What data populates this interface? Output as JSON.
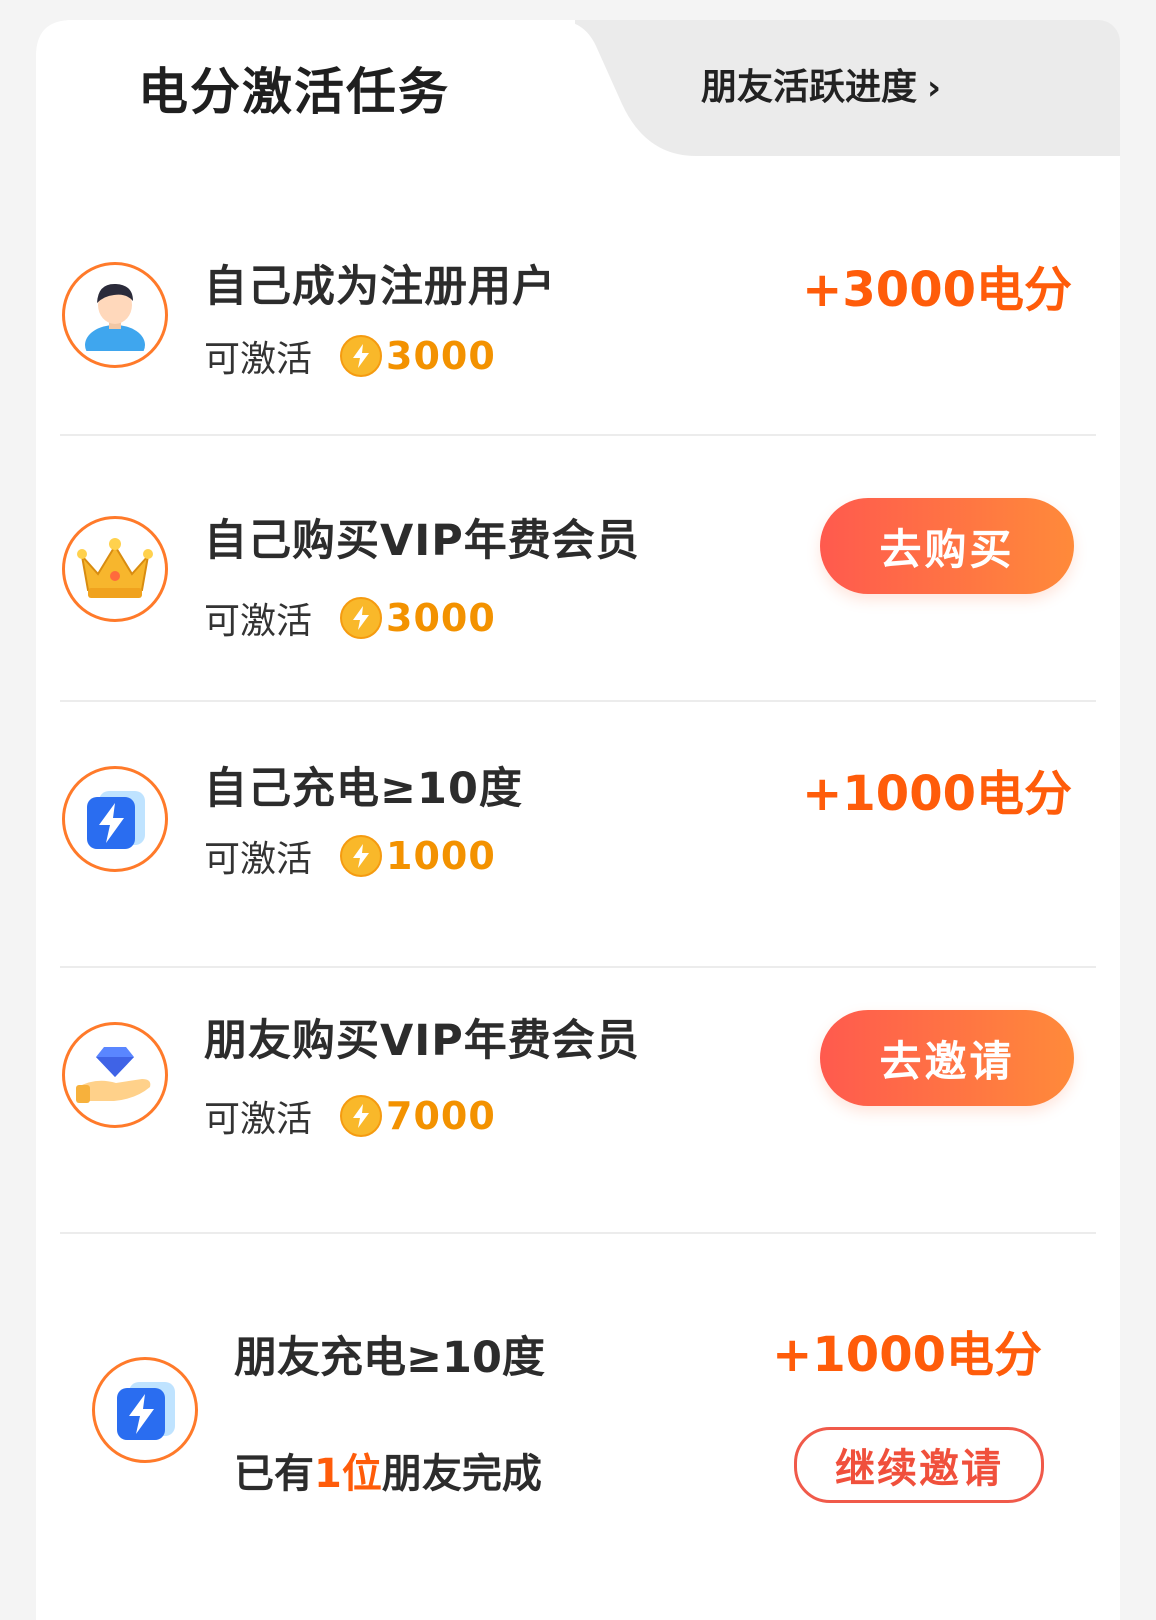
{
  "header": {
    "active_tab": "电分激活任务",
    "inactive_tab": "朋友活跃进度",
    "inactive_chevron": "›"
  },
  "colors": {
    "accent": "#ff5c0a",
    "coin": "#f9b82a",
    "button_start": "#ff5a4e",
    "button_end": "#ff8a3a"
  },
  "tasks": [
    {
      "icon": "user-icon",
      "name": "自己成为注册用户",
      "sub_label": "可激活",
      "amount": "3000",
      "reward": "+3000电分",
      "action": ""
    },
    {
      "icon": "crown-icon",
      "name": "自己购买VIP年费会员",
      "sub_label": "可激活",
      "amount": "3000",
      "reward": "",
      "action": "去购买"
    },
    {
      "icon": "charge-bolt-icon",
      "name": "自己充电≥10度",
      "sub_label": "可激活",
      "amount": "1000",
      "reward": "+1000电分",
      "action": ""
    },
    {
      "icon": "diamond-hand-icon",
      "name": "朋友购买VIP年费会员",
      "sub_label": "可激活",
      "amount": "7000",
      "reward": "",
      "action": "去邀请"
    }
  ],
  "friend_task": {
    "icon": "charge-bolt-icon",
    "name": "朋友充电≥10度",
    "reward": "+1000电分",
    "progress_prefix": "已有",
    "progress_count": "1位",
    "progress_suffix": "朋友完成",
    "action": "继续邀请"
  }
}
